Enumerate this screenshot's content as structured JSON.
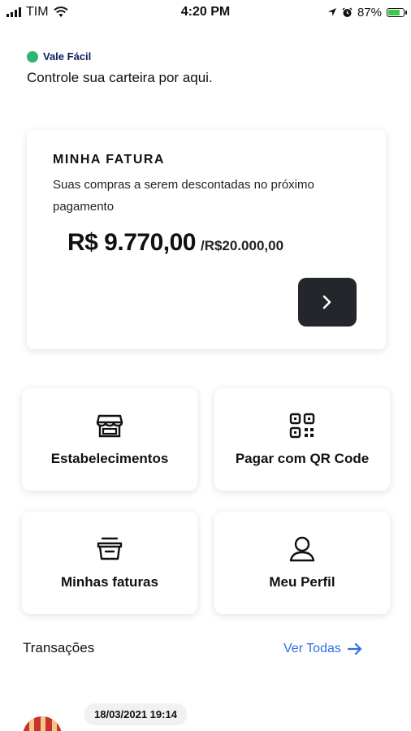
{
  "status_bar": {
    "carrier": "TIM",
    "time": "4:20 PM",
    "battery_percent": "87%",
    "battery_level": 0.87,
    "icons": [
      "signal-icon",
      "wifi-icon",
      "location-icon",
      "alarm-icon",
      "battery-icon"
    ]
  },
  "header": {
    "brand": "Vale Fácil",
    "subtitle": "Controle sua carteira por aqui."
  },
  "invoice": {
    "title": "MINHA FATURA",
    "description": "Suas compras a serem descontadas no próximo pagamento",
    "amount": "R$ 9.770,00",
    "limit": "/R$20.000,00"
  },
  "tiles": [
    {
      "label": "Estabelecimentos",
      "icon": "store-icon"
    },
    {
      "label": "Pagar com QR Code",
      "icon": "qr-code-icon"
    },
    {
      "label": "Minhas faturas",
      "icon": "invoice-basket-icon"
    },
    {
      "label": "Meu Perfil",
      "icon": "user-icon"
    }
  ],
  "transactions": {
    "title": "Transações",
    "see_all": "Ver Todas",
    "items": [
      {
        "date": "18/03/2021 19:14"
      }
    ]
  },
  "colors": {
    "brand_green": "#2bb673",
    "brand_navy": "#0b1f5c",
    "link_blue": "#2d6fe0",
    "dark_button": "#23262a"
  }
}
